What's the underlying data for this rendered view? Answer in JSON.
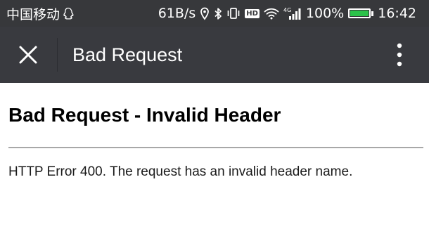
{
  "status_bar": {
    "carrier": "中国移动",
    "carrier_icon": "qq-penguin-icon",
    "network_speed": "61B/s",
    "network_type": "4G",
    "battery_percent": "100%",
    "battery_level": 1.0,
    "time": "16:42",
    "hd_label": "HD",
    "icons": [
      "location-icon",
      "bluetooth-icon",
      "vibrate-icon",
      "hd-icon",
      "wifi-icon",
      "signal-icon",
      "battery-icon"
    ]
  },
  "header": {
    "close_icon": "close-icon",
    "title": "Bad Request",
    "more_icon": "more-vertical-icon"
  },
  "content": {
    "heading": "Bad Request - Invalid Header",
    "message": "HTTP Error 400. The request has an invalid header name."
  },
  "colors": {
    "status_bar_bg": "#37383b",
    "header_bg": "#393a3f",
    "battery_fill": "#2cc24a",
    "rule": "#a8a8a8"
  }
}
